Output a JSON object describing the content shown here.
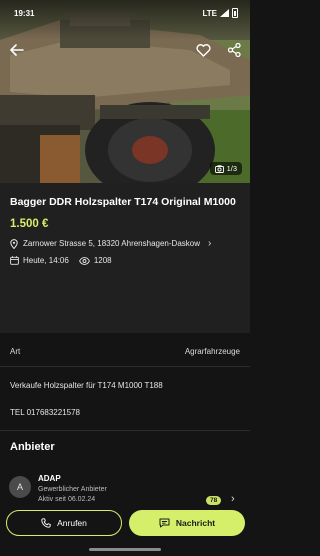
{
  "status_bar": {
    "time": "19:31",
    "network": "LTE"
  },
  "gallery": {
    "counter": "1/3"
  },
  "listing": {
    "title": "Bagger DDR Holzspalter T174 Original M1000",
    "price": "1.500 €",
    "address": "Zarnower Strasse 5, 18320 Ahrenshagen-Daskow",
    "date": "Heute, 14:06",
    "views": "1208"
  },
  "attributes": [
    {
      "label": "Art",
      "value": "Agrarfahrzeuge"
    }
  ],
  "description": {
    "line1": "Verkaufe Holzspalter für T174 M1000 T188",
    "line2": "TEL 017683221578"
  },
  "seller": {
    "section_title": "Anbieter",
    "initial": "A",
    "name": "ADAP",
    "type": "Gewerblicher Anbieter",
    "since": "Aktiv seit 06.02.24",
    "rating": "78"
  },
  "actions": {
    "call_label": "Anrufen",
    "message_label": "Nachricht"
  },
  "colors": {
    "accent": "#d6ef6a",
    "background": "#141414",
    "card": "#202020"
  },
  "icons": [
    "back-arrow-icon",
    "heart-icon",
    "share-icon",
    "camera-icon",
    "location-pin-icon",
    "calendar-icon",
    "eye-icon",
    "phone-icon",
    "chat-icon",
    "chevron-right-icon"
  ]
}
